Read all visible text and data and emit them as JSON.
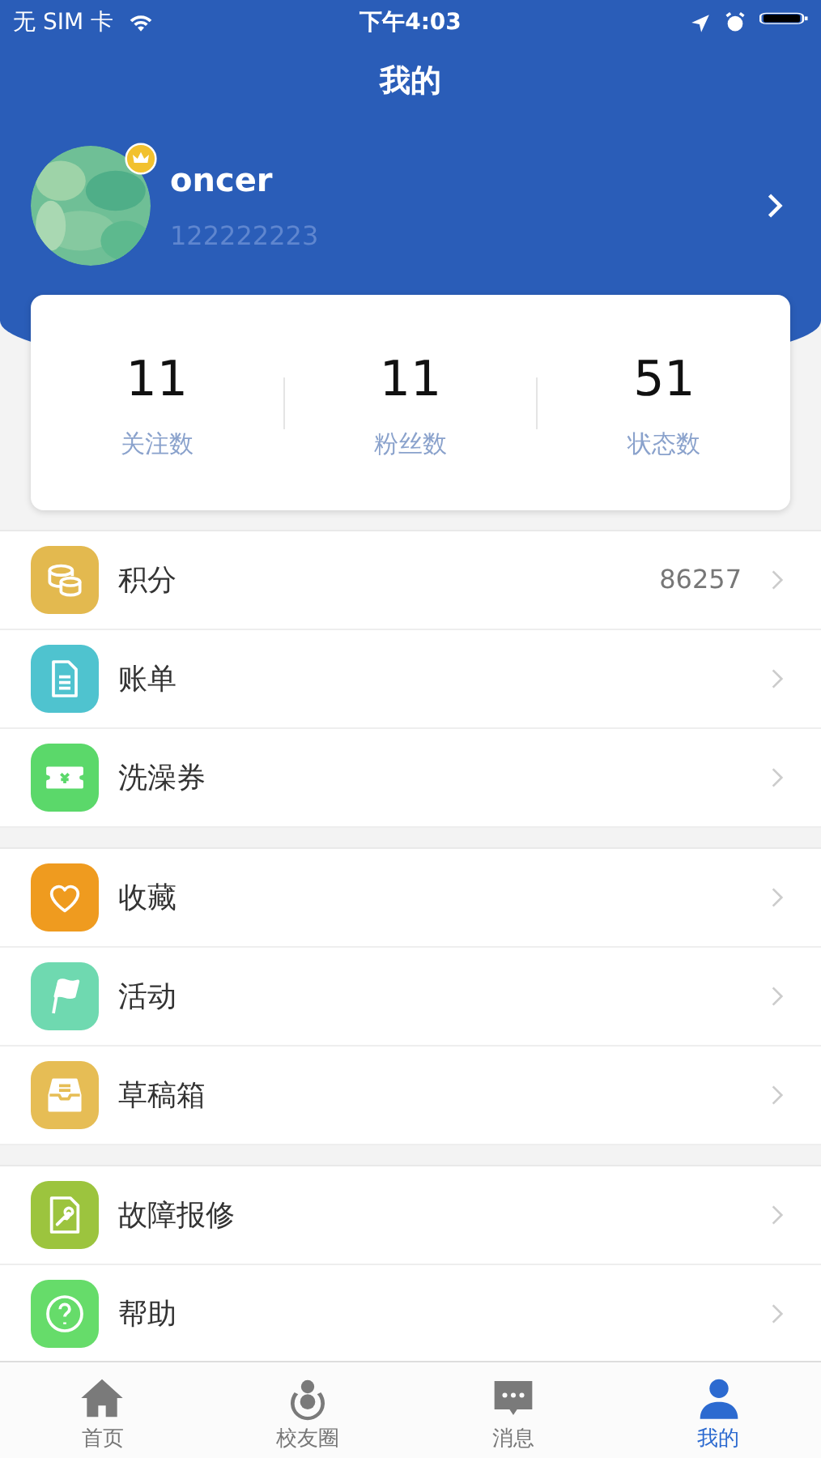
{
  "status_bar": {
    "carrier": "无 SIM 卡",
    "time": "下午4:03"
  },
  "title": "我的",
  "profile": {
    "name": "oncer",
    "id": "122222223",
    "vip": true
  },
  "stats": [
    {
      "value": "11",
      "label": "关注数"
    },
    {
      "value": "11",
      "label": "粉丝数"
    },
    {
      "value": "51",
      "label": "状态数"
    }
  ],
  "menu_groups": [
    [
      {
        "kind": "coins",
        "color": "#e3b94f",
        "label": "积分",
        "value": "86257"
      },
      {
        "kind": "document",
        "color": "#4fc3cf",
        "label": "账单"
      },
      {
        "kind": "ticket",
        "color": "#5bd86a",
        "label": "洗澡券"
      }
    ],
    [
      {
        "kind": "heart",
        "color": "#ef9b1f",
        "label": "收藏"
      },
      {
        "kind": "flag",
        "color": "#6fd9b0",
        "label": "活动"
      },
      {
        "kind": "inbox",
        "color": "#e6bd55",
        "label": "草稿箱"
      }
    ],
    [
      {
        "kind": "repair",
        "color": "#9cc43e",
        "label": "故障报修"
      },
      {
        "kind": "help",
        "color": "#66dc6a",
        "label": "帮助"
      }
    ]
  ],
  "tabs": [
    {
      "kind": "home",
      "label": "首页",
      "selected": false
    },
    {
      "kind": "circle",
      "label": "校友圈",
      "selected": false
    },
    {
      "kind": "chat",
      "label": "消息",
      "selected": false
    },
    {
      "kind": "person",
      "label": "我的",
      "selected": true
    }
  ]
}
